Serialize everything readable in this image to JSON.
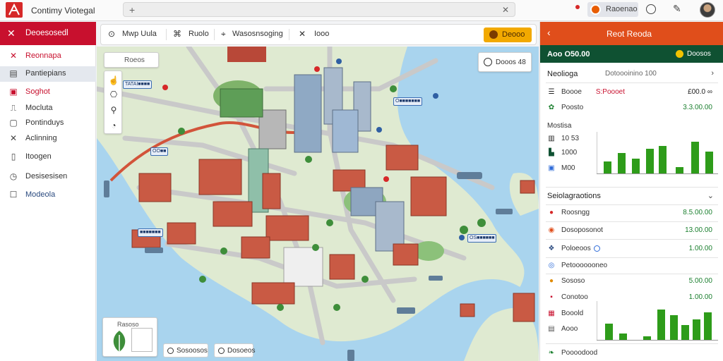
{
  "app": {
    "title": "Contimy Viotegal"
  },
  "topbar": {
    "action_label": "Raoenao",
    "accent": "#c8102e"
  },
  "sidebar": {
    "header": "Deoesosedl",
    "items": [
      {
        "label": "Reonnapa",
        "icon": "cross-tools-icon"
      },
      {
        "label": "Pantiepians",
        "icon": "document-icon"
      },
      {
        "label": "Soghot",
        "icon": "tag-icon"
      },
      {
        "label": "Mocluta",
        "icon": "inbox-icon"
      },
      {
        "label": "Pontinduys",
        "icon": "box-icon"
      },
      {
        "label": "Aclinning",
        "icon": "tools-icon"
      },
      {
        "label": "Itoogen",
        "icon": "file-icon"
      },
      {
        "label": "Desisesisen",
        "icon": "clock-icon"
      },
      {
        "label": "Modeola",
        "icon": "phone-icon"
      }
    ]
  },
  "map_toolbar": {
    "items": [
      "Mwp Uula",
      "Ruolo",
      "Wasosnsoging",
      "Iooo"
    ],
    "button_label": "Deooo"
  },
  "map": {
    "search_chip": "Roeos",
    "status_chip": "Dooos 48",
    "legend_label": "Rasoso",
    "pill_1": "Sosoosos",
    "pill_2": "Dosoeos",
    "tags": [
      "TATAI■■■■",
      "O■■■■■■■",
      "OO■■",
      "■■■■■■■",
      "OS■■■■■■"
    ]
  },
  "right_panel": {
    "title": "Reot Reoda",
    "sub_value": "Aoo O50.00",
    "sub_label": "Doosos",
    "section1": {
      "title": "Neolioga",
      "sub": "Dotoooinino 100"
    },
    "rows1": [
      {
        "label": "Boooe",
        "val": "£00.0 ∞",
        "mid": "S:Poooet",
        "val_class": "red"
      },
      {
        "label": "Poosto",
        "val": "3.3.00.00",
        "val_class": "green"
      }
    ],
    "mini1": {
      "labels": [
        "10 53",
        "1000",
        "M00"
      ],
      "caption": "Mostisa"
    },
    "section2": {
      "title": "Seiolagraotions"
    },
    "rows2": [
      {
        "label": "Roosngg",
        "val": "8.5.00.00"
      },
      {
        "label": "Dosoposonot",
        "val": "13.00.00"
      },
      {
        "label": "Poloeoos",
        "val": "1.00.00"
      },
      {
        "label": "Petooooooneo",
        "val": ""
      },
      {
        "label": "Sososo",
        "val": "5.00.00"
      },
      {
        "label": "Conotoo",
        "val": "1.00.00"
      },
      {
        "label": "Booold",
        "val": ""
      },
      {
        "label": "Aooo",
        "val": ""
      }
    ],
    "footer": "Poooodood"
  },
  "colors": {
    "red": "#c8102e",
    "orange": "#e04e1b",
    "dark_green": "#0f5132",
    "bar_green": "#2e9c1a",
    "water": "#a9d4ee"
  }
}
